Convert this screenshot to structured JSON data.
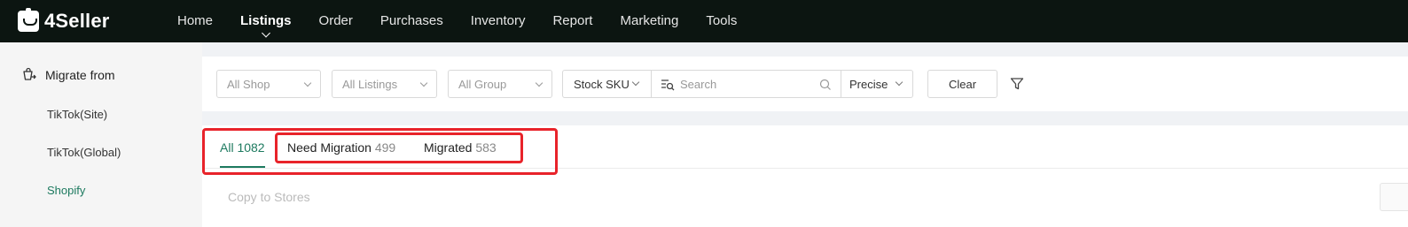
{
  "app": {
    "logo_text": "4Seller",
    "nav": [
      "Home",
      "Listings",
      "Order",
      "Purchases",
      "Inventory",
      "Report",
      "Marketing",
      "Tools"
    ],
    "active_nav": "Listings"
  },
  "sidebar": {
    "heading": "Migrate from",
    "items": [
      "TikTok(Site)",
      "TikTok(Global)",
      "Shopify"
    ],
    "active_item": "Shopify"
  },
  "filters": {
    "shop": "All Shop",
    "listings": "All Listings",
    "group": "All Group",
    "search_type": "Stock SKU",
    "search_placeholder": "Search",
    "match_mode": "Precise",
    "clear_label": "Clear"
  },
  "tabs": [
    {
      "label": "All",
      "count": "1082"
    },
    {
      "label": "Need Migration",
      "count": "499"
    },
    {
      "label": "Migrated",
      "count": "583"
    }
  ],
  "active_tab": "All",
  "actions": {
    "copy_to_stores": "Copy to Stores"
  },
  "colors": {
    "accent": "#1d7a5f",
    "topbar": "#0c1511",
    "highlight": "#e8232a"
  }
}
